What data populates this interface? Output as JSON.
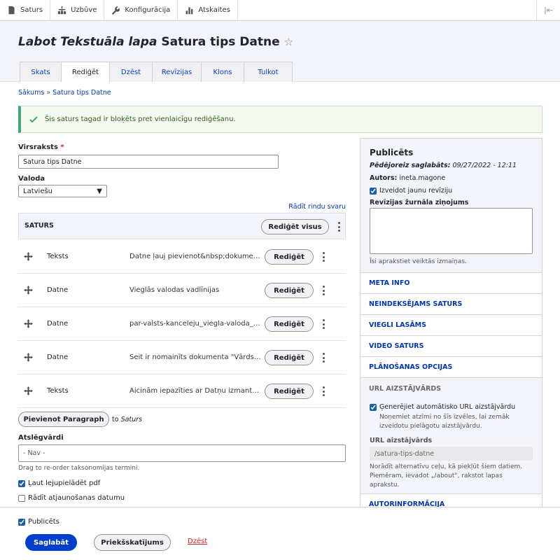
{
  "toolbar": {
    "items": [
      {
        "label": "Saturs",
        "icon": "file-icon"
      },
      {
        "label": "Uzbūve",
        "icon": "structure-icon"
      },
      {
        "label": "Konfigurācija",
        "icon": "wrench-icon"
      },
      {
        "label": "Atskaites",
        "icon": "bar-chart-icon"
      }
    ],
    "collapse_icon": "collapse-sidebar-icon"
  },
  "header": {
    "title_italic": "Labot Tekstuāla lapa",
    "title_rest": "Satura tips Datne",
    "tabs": [
      "Skats",
      "Rediģēt",
      "Dzēst",
      "Revīzijas",
      "Klons",
      "Tulkot"
    ],
    "active_tab": "Rediģēt"
  },
  "breadcrumb": {
    "home": "Sākums",
    "separator": "»",
    "current": "Satura tips Datne"
  },
  "message": {
    "text": "Šis saturs tagad ir bloķēts pret vienlaicīgu rediģēšanu.",
    "color": "#42a877"
  },
  "form": {
    "title_label": "Virsraksts",
    "title_value": "Satura tips Datne",
    "language_label": "Valoda",
    "language_value": "Latviešu",
    "row_weights_link": "Rādīt rindu svaru",
    "paragraphs_header": "SATURS",
    "edit_all": "Rediģēt visus",
    "rows": [
      {
        "type": "Teksts",
        "summary": "Datne ļauj pievienot&nbsp;dokumentu...",
        "button": "Rediģēt"
      },
      {
        "type": "Datne",
        "summary": "Vieglās valodas vadlīnijas",
        "button": "Rediģēt"
      },
      {
        "type": "Datne",
        "summary": "par-valsts-kanceleju_viegla-valoda_de...",
        "button": "Rediģēt"
      },
      {
        "type": "Datne",
        "summary": "Šeit ir nomainīts dokumenta \"Vārds\" to...",
        "button": "Rediģēt"
      },
      {
        "type": "Teksts",
        "summary": "Aicinām iepazīties ar Datņu izmantoša...",
        "button": "Rediģēt"
      }
    ],
    "add_paragraph": "Pievienot Paragraph",
    "add_to": "to",
    "add_target": "Saturs",
    "keywords_label": "Atslēgvārdi",
    "keywords_value": "- Nav -",
    "keywords_help": "Drag to re-order taksonomijas termini.",
    "allow_pdf": "Ļaut lejupielādēt pdf",
    "show_update": "Rādīt atjaunošanas datumu"
  },
  "sidebar": {
    "status": "Publicēts",
    "last_saved_label": "Pēdējoreiz saglabāts:",
    "last_saved_value": "09/27/2022 - 12:11",
    "author_label": "Autors:",
    "author_value": "ineta.magone",
    "new_revision": "Izveidot jaunu revīziju",
    "revision_log_label": "Revīzijas žurnāla ziņojums",
    "revision_help": "Īsi aprakstiet veiktās izmaiņas.",
    "sections": [
      "META INFO",
      "NEINDEKSĒJAMS SATURS",
      "VIEGLI LASĀMS",
      "VIDEO SATURS",
      "PLĀNOŠANAS OPCIJAS"
    ],
    "url_section": "URL AIZSTĀJVĀRDS",
    "url_generate": "Ģenerējiet automātisko URL aizstājvārdu",
    "url_generate_help": "Noņemiet atzīmi no šīs izvēles, lai zemāk izveidotu pielāgotu aizstājvārdu.",
    "url_alias_label": "URL aizstājvārds",
    "url_alias_value": "/satura-tips-datne",
    "url_alias_help": "Norādīt alternatīvu ceļu, kā piekļūt šiem datiem. Piemēram, ievadot „/about\", rakstot lapas aprakstu.",
    "author_info": "AUTORINFORMĀCIJA"
  },
  "footer": {
    "published": "Publicēts",
    "save": "Saglabāt",
    "preview": "Priekšskatījums",
    "delete": "Dzēst"
  },
  "colors": {
    "primary": "#003ecc",
    "link": "#0036b1",
    "danger": "#dc2323"
  }
}
